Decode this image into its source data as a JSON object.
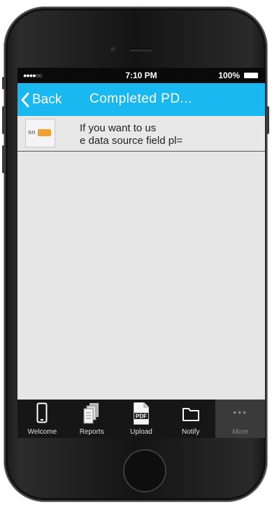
{
  "status_bar": {
    "signal": "●●●●○○",
    "time": "7:10 PM",
    "battery": "100%"
  },
  "nav_bar": {
    "back_label": "Back",
    "title": "Completed PD..."
  },
  "list": {
    "items": [
      {
        "thumbnail_text": "sn",
        "line1": "If you want to us",
        "line2": "e data source field pl="
      }
    ]
  },
  "tab_bar": {
    "tabs": [
      {
        "label": "Welcome",
        "icon": "phone-icon"
      },
      {
        "label": "Reports",
        "icon": "documents-icon"
      },
      {
        "label": "Upload",
        "icon": "pdf-icon",
        "icon_text": "PDF"
      },
      {
        "label": "Notify",
        "icon": "folder-icon"
      },
      {
        "label": "More",
        "icon": "more-dots-icon",
        "icon_text": "•••",
        "selected": true
      }
    ]
  },
  "colors": {
    "nav_bar": "#1ab8f0",
    "tab_bar": "#161616",
    "screen_bg": "#e6e6e6"
  }
}
